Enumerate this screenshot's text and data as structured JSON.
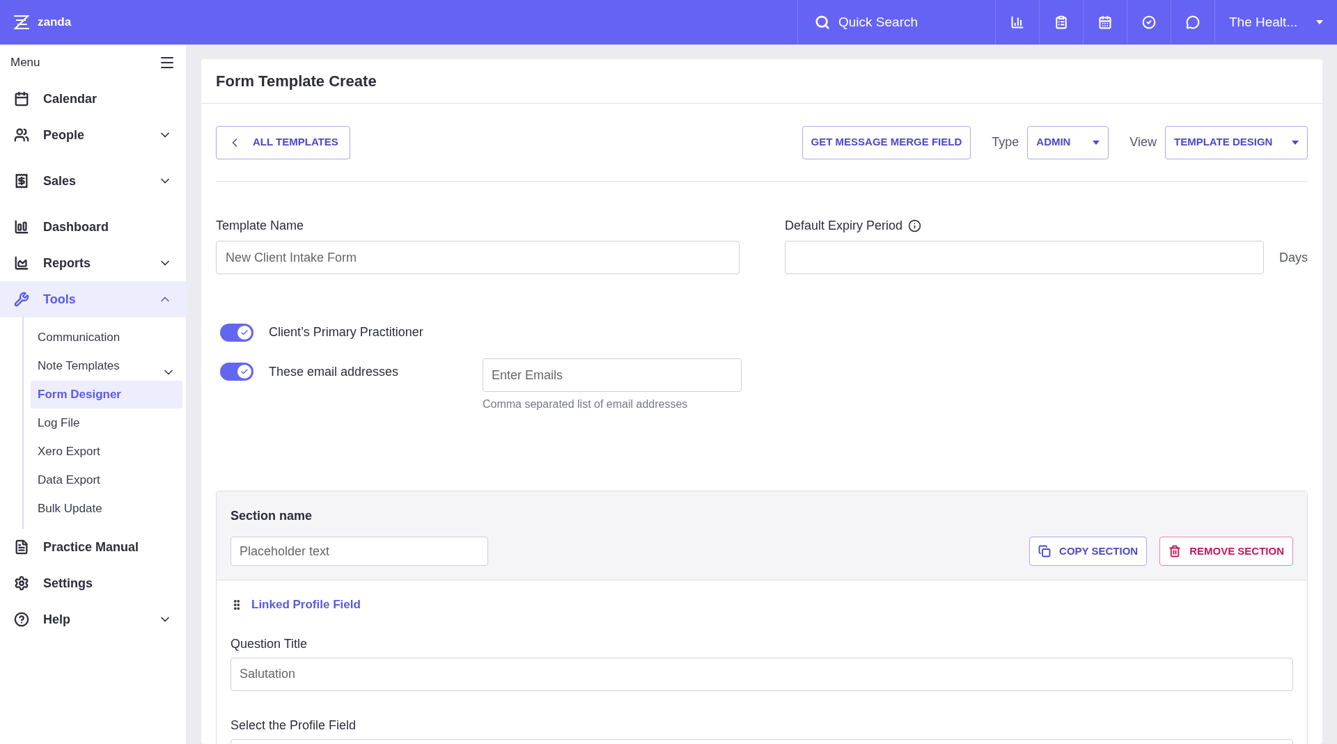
{
  "topbar": {
    "logo": "zanda",
    "search": {
      "placeholder": "Quick Search"
    },
    "account": "The Healt..."
  },
  "sidebar": {
    "title": "Menu",
    "items": [
      {
        "label": "Calendar",
        "selected": false
      },
      {
        "label": "People",
        "selected": false,
        "expanded": false
      },
      {
        "label": "Sales",
        "selected": false,
        "expanded": false
      },
      {
        "label": "Dashboard",
        "selected": false
      },
      {
        "label": "Reports",
        "selected": false,
        "expanded": false
      },
      {
        "label": "Tools",
        "selected": true,
        "expanded": true,
        "children": [
          {
            "label": "Communication",
            "selected": false
          },
          {
            "label": "Note Templates",
            "selected": false,
            "expanded": false
          },
          {
            "label": "Form Designer",
            "selected": true
          },
          {
            "label": "Log File",
            "selected": false
          },
          {
            "label": "Xero Export",
            "selected": false
          },
          {
            "label": "Data Export",
            "selected": false
          },
          {
            "label": "Bulk Update",
            "selected": false
          }
        ]
      },
      {
        "label": "Practice Manual",
        "selected": false
      },
      {
        "label": "Settings",
        "selected": false
      },
      {
        "label": "Help",
        "selected": false,
        "expanded": false
      }
    ]
  },
  "page": {
    "title": "Form Template Create",
    "back_button": "ALL TEMPLATES",
    "merge_button": "GET MESSAGE MERGE FIELD",
    "type": {
      "label": "Type",
      "value": "ADMIN"
    },
    "view": {
      "label": "View",
      "value": "TEMPLATE DESIGN"
    },
    "template_name": {
      "label": "Template Name",
      "value": "New Client Intake Form"
    },
    "expiry": {
      "label": "Default Expiry Period",
      "unit": "Days"
    },
    "toggles": [
      {
        "label": "Client’s Primary Practitioner",
        "on": true
      },
      {
        "label": "These email addresses",
        "on": true
      }
    ],
    "emails": {
      "placeholder": "Enter Emails",
      "hint": "Comma separated list of email addresses"
    },
    "section": {
      "title": "Section name",
      "name": {
        "placeholder": "Placeholder text"
      },
      "copy_button": "COPY SECTION",
      "remove_button": "REMOVE SECTION",
      "field_type": "Linked Profile Field",
      "question_title": {
        "label": "Question Title",
        "value": "Salutation"
      },
      "profile_field": {
        "label": "Select the Profile Field"
      }
    }
  }
}
